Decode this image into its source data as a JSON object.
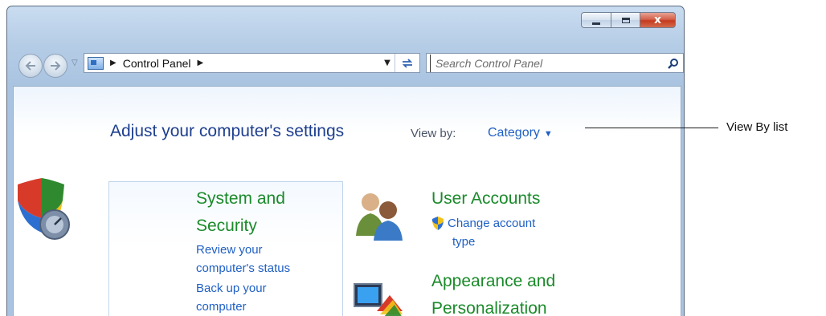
{
  "window": {
    "caption_buttons": [
      "minimize",
      "maximize",
      "close"
    ],
    "close_glyph": "x"
  },
  "navigation": {
    "back_icon": "back-arrow-icon",
    "forward_icon": "forward-arrow-icon"
  },
  "address_bar": {
    "crumbs": [
      "Control Panel"
    ]
  },
  "search": {
    "placeholder": "Search Control Panel"
  },
  "content": {
    "title": "Adjust your computer's settings",
    "view_by": {
      "label": "View by:",
      "selected": "Category"
    },
    "categories": [
      {
        "title_line1": "System and",
        "title_line2": "Security",
        "links": [
          "Review your computer's status",
          "Back up your computer"
        ],
        "link_lines": [
          "Review your",
          "computer's status",
          "Back up your",
          "computer"
        ]
      },
      {
        "title": "User Accounts",
        "link_lines": [
          "Change account",
          "type"
        ]
      },
      {
        "title_line1": "Appearance and",
        "title_line2": "Personalization"
      }
    ]
  },
  "annotation": {
    "label": "View By list"
  },
  "colors": {
    "accent_blue": "#1f60c4",
    "title_blue": "#1e3f8f",
    "category_green": "#1a8a2a",
    "close_red": "#c43a1f"
  }
}
